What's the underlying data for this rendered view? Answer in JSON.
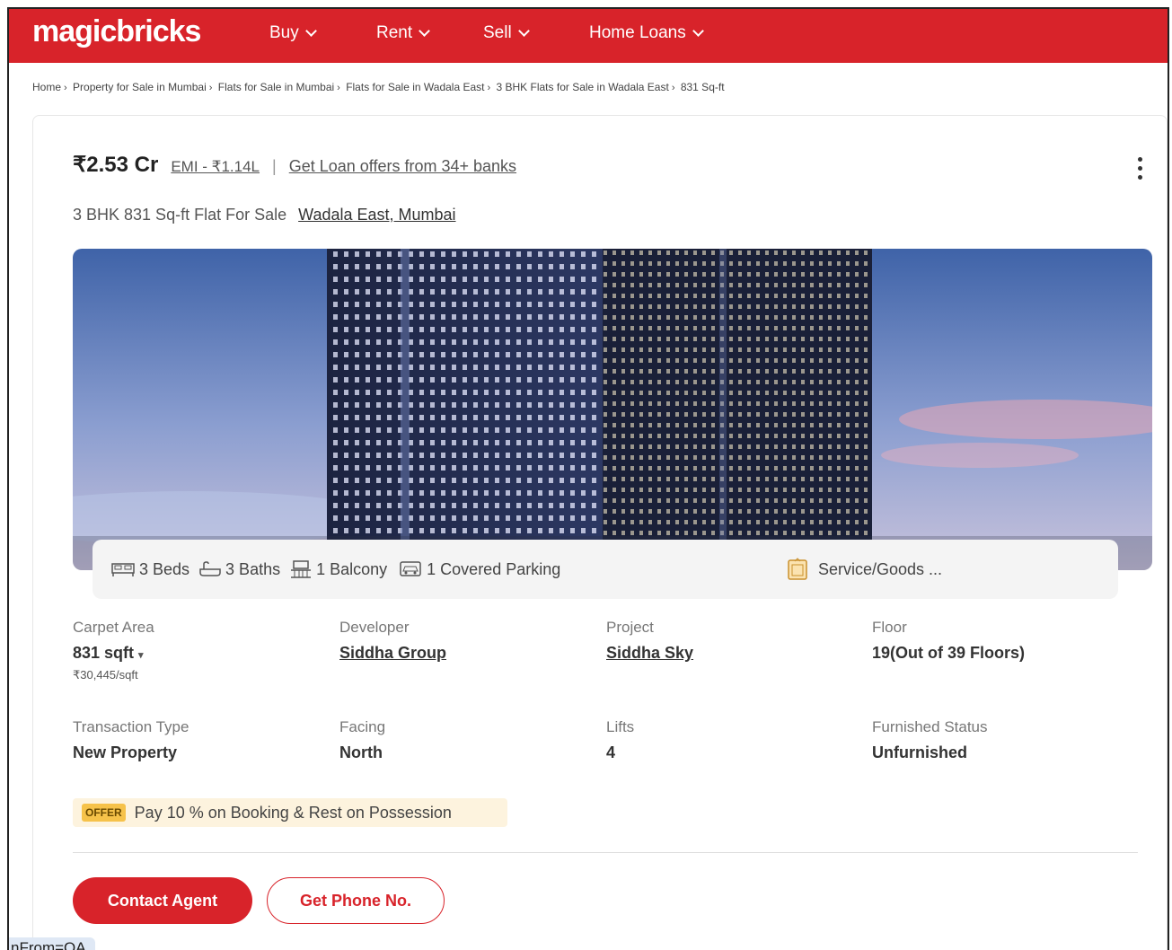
{
  "brand": {
    "logo": "magicbricks",
    "accent": "#d8232a"
  },
  "nav": {
    "items": [
      {
        "label": "Buy"
      },
      {
        "label": "Rent"
      },
      {
        "label": "Sell"
      },
      {
        "label": "Home Loans"
      }
    ]
  },
  "breadcrumb": [
    "Home",
    "Property for Sale in Mumbai",
    "Flats for Sale in Mumbai",
    "Flats for Sale in Wadala East",
    "3 BHK Flats for Sale in Wadala East",
    "831 Sq-ft"
  ],
  "listing": {
    "price": "₹2.53 Cr",
    "emi": "EMI - ₹1.14L",
    "separator": "|",
    "loan_offer": "Get Loan offers from 34+ banks",
    "title": "3 BHK 831 Sq-ft Flat For Sale",
    "location": "Wadala East, Mumbai"
  },
  "amenities": {
    "beds": "3 Beds",
    "baths": "3 Baths",
    "balcony": "1 Balcony",
    "parking": "1 Covered Parking",
    "service": "Service/Goods ..."
  },
  "details": {
    "carpet_area": {
      "label": "Carpet Area",
      "value": "831 sqft",
      "sub": "₹30,445/sqft"
    },
    "developer": {
      "label": "Developer",
      "value": "Siddha Group"
    },
    "project": {
      "label": "Project",
      "value": "Siddha Sky"
    },
    "floor": {
      "label": "Floor",
      "value": "19(Out of 39 Floors)"
    },
    "transaction": {
      "label": "Transaction Type",
      "value": "New Property"
    },
    "facing": {
      "label": "Facing",
      "value": "North"
    },
    "lifts": {
      "label": "Lifts",
      "value": "4"
    },
    "furnished": {
      "label": "Furnished Status",
      "value": "Unfurnished"
    }
  },
  "offer": {
    "badge": "OFFER",
    "text": "Pay 10 % on Booking & Rest on Possession"
  },
  "actions": {
    "contact": "Contact Agent",
    "phone": "Get Phone No."
  },
  "status_bar": {
    "text": "nFrom=QA"
  }
}
